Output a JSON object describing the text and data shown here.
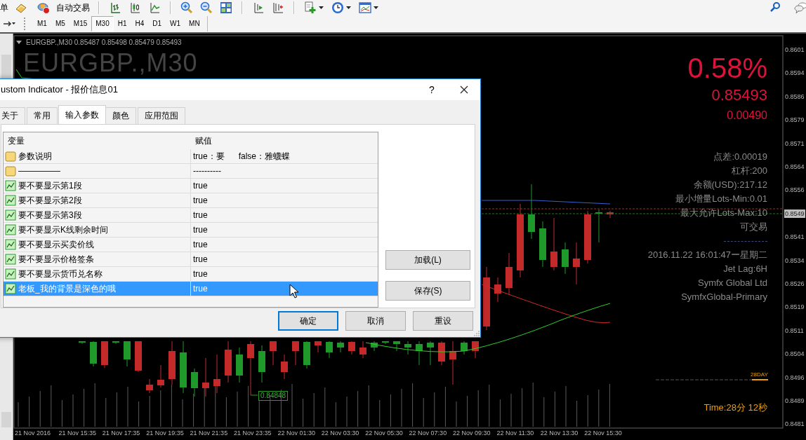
{
  "toolbar": {
    "orders_label": "单",
    "autotrading_label": "自动交易"
  },
  "timeframes": [
    {
      "label": "M1",
      "selected": false
    },
    {
      "label": "M5",
      "selected": false
    },
    {
      "label": "M15",
      "selected": false
    },
    {
      "label": "M30",
      "selected": true
    },
    {
      "label": "H1",
      "selected": false
    },
    {
      "label": "H4",
      "selected": false
    },
    {
      "label": "D1",
      "selected": false
    },
    {
      "label": "W1",
      "selected": false
    },
    {
      "label": "MN",
      "selected": false
    }
  ],
  "chart": {
    "header": "EURGBP.,M30  0.85487 0.85498 0.85479 0.85493",
    "symbol_label": "EURGBP.,M30",
    "info": [
      {
        "kind": "percent",
        "text": "0.58%"
      },
      {
        "kind": "price",
        "text": "0.85493"
      },
      {
        "kind": "change",
        "text": "0.00490"
      },
      {
        "kind": "text",
        "text": "点差:0.00019"
      },
      {
        "kind": "text",
        "text": "杠杆:200"
      },
      {
        "kind": "text",
        "text": "余额(USD):217.12"
      },
      {
        "kind": "text",
        "text": "最小增量Lots-Min:0.01"
      },
      {
        "kind": "text",
        "text": "最大允许Lots-Max:10"
      },
      {
        "kind": "text",
        "text": "可交易"
      },
      {
        "kind": "divider"
      },
      {
        "kind": "text",
        "text": "2016.11.22 16:01:47ー星期二"
      },
      {
        "kind": "text",
        "text": "Jet Lag:6H"
      },
      {
        "kind": "text",
        "text": "Symfx Global Ltd"
      },
      {
        "kind": "text",
        "text": "SymfxGlobal-Primary"
      }
    ],
    "price_axis": [
      {
        "label": "0.8601",
        "current": false
      },
      {
        "label": "0.8594",
        "current": false
      },
      {
        "label": "0.8586",
        "current": false
      },
      {
        "label": "0.8579",
        "current": false
      },
      {
        "label": "0.8571",
        "current": false
      },
      {
        "label": "0.8564",
        "current": false
      },
      {
        "label": "0.8556",
        "current": false
      },
      {
        "label": "0.8549",
        "current": true
      },
      {
        "label": "0.8541",
        "current": false
      },
      {
        "label": "0.8534",
        "current": false
      },
      {
        "label": "0.8526",
        "current": false
      },
      {
        "label": "0.8519",
        "current": false
      },
      {
        "label": "0.8511",
        "current": false
      },
      {
        "label": "0.8504",
        "current": false
      },
      {
        "label": "0.8496",
        "current": false
      },
      {
        "label": "0.8489",
        "current": false
      },
      {
        "label": "0.8481",
        "current": false
      }
    ],
    "time_axis": [
      "21 Nov 2016",
      "21 Nov 15:35",
      "21 Nov 17:35",
      "21 Nov 19:35",
      "21 Nov 21:35",
      "21 Nov 23:35",
      "22 Nov 01:30",
      "22 Nov 03:30",
      "22 Nov 05:30",
      "22 Nov 07:30",
      "22 Nov 09:30",
      "22 Nov 11:30",
      "22 Nov 13:30",
      "22 Nov 15:30"
    ],
    "low_price_label": "0.84848",
    "day_label": "28DAY",
    "timer": "Time:28分 12秒"
  },
  "dialog": {
    "title": "ustom Indicator - 报价信息01",
    "help_button": "?",
    "tabs": [
      {
        "label": "关于",
        "selected": false
      },
      {
        "label": "常用",
        "selected": false
      },
      {
        "label": "输入参数",
        "selected": true
      },
      {
        "label": "颜色",
        "selected": false
      },
      {
        "label": "应用范围",
        "selected": false
      }
    ],
    "columns": [
      "变量",
      "赋值"
    ],
    "rows": [
      {
        "kind": "text",
        "variable": "参数说明",
        "value": "true：要      false：雅蠛蝶",
        "selected": false
      },
      {
        "kind": "text",
        "variable": "—————",
        "value": "----------",
        "selected": false
      },
      {
        "kind": "bool",
        "variable": "要不要显示第1段",
        "value": "true",
        "selected": false
      },
      {
        "kind": "bool",
        "variable": "要不要显示第2段",
        "value": "true",
        "selected": false
      },
      {
        "kind": "bool",
        "variable": "要不要显示第3段",
        "value": "true",
        "selected": false
      },
      {
        "kind": "bool",
        "variable": "要不要显示K线剩余时间",
        "value": "true",
        "selected": false
      },
      {
        "kind": "bool",
        "variable": "要不要显示买卖价线",
        "value": "true",
        "selected": false
      },
      {
        "kind": "bool",
        "variable": "要不要显示价格签条",
        "value": "true",
        "selected": false
      },
      {
        "kind": "bool",
        "variable": "要不要显示货币兑名称",
        "value": "true",
        "selected": false
      },
      {
        "kind": "bool",
        "variable": "老板_我的背景是深色的哦",
        "value": "true",
        "selected": true
      }
    ],
    "side_buttons": [
      "加载(L)",
      "保存(S)"
    ],
    "buttons": [
      {
        "label": "确定",
        "default": true
      },
      {
        "label": "取消",
        "default": false
      },
      {
        "label": "重设",
        "default": false
      }
    ]
  }
}
